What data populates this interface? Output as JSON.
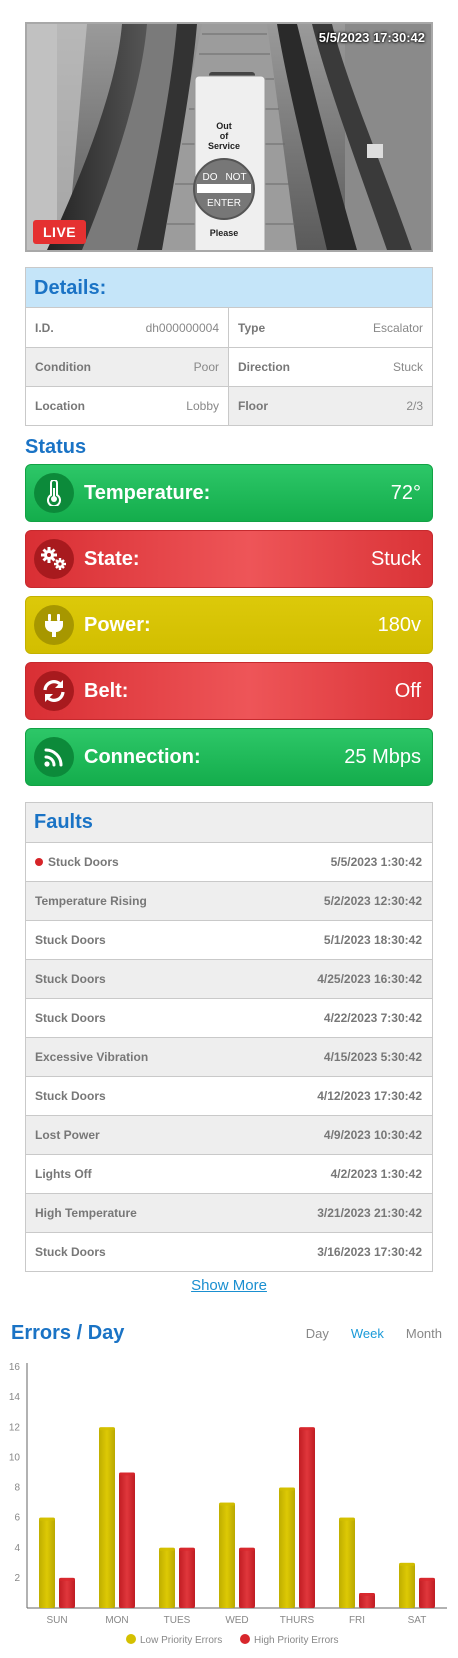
{
  "camera": {
    "timestamp": "5/5/2023 17:30:42",
    "live_label": "LIVE",
    "sign_text": [
      "Out",
      "of",
      "Service"
    ],
    "sign_bar_text": [
      "DO",
      "NOT",
      "ENTER"
    ],
    "sign_bottom": "Please"
  },
  "details": {
    "title": "Details:",
    "fields": [
      {
        "key": "I.D.",
        "value": "dh000000004"
      },
      {
        "key": "Type",
        "value": "Escalator"
      },
      {
        "key": "Condition",
        "value": "Poor"
      },
      {
        "key": "Direction",
        "value": "Stuck"
      },
      {
        "key": "Location",
        "value": "Lobby"
      },
      {
        "key": "Floor",
        "value": "2/3"
      }
    ]
  },
  "status": {
    "title": "Status",
    "items": [
      {
        "label": "Temperature:",
        "value": "72°",
        "color": "green",
        "icon": "thermometer-icon"
      },
      {
        "label": "State:",
        "value": "Stuck",
        "color": "red",
        "icon": "gears-icon"
      },
      {
        "label": "Power:",
        "value": "180v",
        "color": "yellow",
        "icon": "plug-icon"
      },
      {
        "label": "Belt:",
        "value": "Off",
        "color": "red",
        "icon": "refresh-icon"
      },
      {
        "label": "Connection:",
        "value": "25 Mbps",
        "color": "green",
        "icon": "signal-icon"
      }
    ]
  },
  "faults": {
    "title": "Faults",
    "rows": [
      {
        "name": "Stuck Doors",
        "time": "5/5/2023 1:30:42",
        "active": true
      },
      {
        "name": "Temperature Rising",
        "time": "5/2/2023 12:30:42"
      },
      {
        "name": "Stuck Doors",
        "time": "5/1/2023 18:30:42"
      },
      {
        "name": "Stuck Doors",
        "time": "4/25/2023 16:30:42"
      },
      {
        "name": "Stuck Doors",
        "time": "4/22/2023 7:30:42"
      },
      {
        "name": "Excessive Vibration",
        "time": "4/15/2023 5:30:42"
      },
      {
        "name": "Stuck Doors",
        "time": "4/12/2023 17:30:42"
      },
      {
        "name": "Lost Power",
        "time": "4/9/2023 10:30:42"
      },
      {
        "name": "Lights Off",
        "time": "4/2/2023 1:30:42"
      },
      {
        "name": "High Temperature",
        "time": "3/21/2023 21:30:42"
      },
      {
        "name": "Stuck Doors",
        "time": "3/16/2023 17:30:42"
      }
    ],
    "show_more": "Show More"
  },
  "errors_chart": {
    "title": "Errors / Day",
    "tabs": [
      "Day",
      "Week",
      "Month"
    ],
    "active_tab": "Week"
  },
  "colors": {
    "accent": "#1a73c5",
    "green": "#1db956",
    "red": "#e03b3f",
    "yellow": "#d6c302",
    "low_priority": "#d4c000",
    "high_priority": "#d8262c"
  },
  "chart_data": {
    "type": "bar",
    "categories": [
      "SUN",
      "MON",
      "TUES",
      "WED",
      "THURS",
      "FRI",
      "SAT"
    ],
    "series": [
      {
        "name": "Low Priority Errors",
        "values": [
          6,
          12,
          4,
          7,
          8,
          6,
          3
        ]
      },
      {
        "name": "High Priority Errors",
        "values": [
          2,
          9,
          4,
          4,
          12,
          1,
          2
        ]
      }
    ],
    "ylim": [
      0,
      16
    ],
    "yticks": [
      2,
      4,
      6,
      8,
      10,
      12,
      14,
      16
    ],
    "legend_position": "bottom",
    "grid": false
  }
}
